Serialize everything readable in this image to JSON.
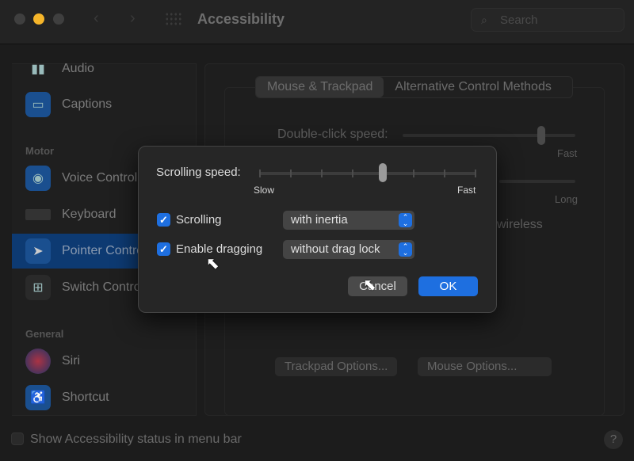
{
  "window": {
    "title": "Accessibility",
    "search_placeholder": "Search"
  },
  "sidebar": {
    "items": [
      {
        "label": "Audio",
        "icon": "audio-icon"
      },
      {
        "label": "Captions",
        "icon": "captions-icon"
      },
      {
        "section": "Motor"
      },
      {
        "label": "Voice Control",
        "icon": "voice-control-icon"
      },
      {
        "label": "Keyboard",
        "icon": "keyboard-icon"
      },
      {
        "label": "Pointer Control",
        "icon": "pointer-icon",
        "selected": true
      },
      {
        "label": "Switch Control",
        "icon": "switch-control-icon"
      },
      {
        "section": "General"
      },
      {
        "label": "Siri",
        "icon": "siri-icon"
      },
      {
        "label": "Shortcut",
        "icon": "shortcut-icon"
      }
    ]
  },
  "tabs": [
    "Mouse & Trackpad",
    "Alternative Control Methods"
  ],
  "background": {
    "double_click_label": "Double-click speed:",
    "double_click_value": 0.8,
    "fast": "Fast",
    "long": "Long",
    "wireless": "wireless",
    "trackpad_options": "Trackpad Options...",
    "mouse_options": "Mouse Options..."
  },
  "dialog": {
    "scrolling_speed_label": "Scrolling speed:",
    "scrolling_speed_value": 0.57,
    "slow": "Slow",
    "fast": "Fast",
    "scrolling": {
      "label": "Scrolling",
      "checked": true,
      "option": "with inertia"
    },
    "dragging": {
      "label": "Enable dragging",
      "checked": true,
      "option": "without drag lock"
    },
    "cancel": "Cancel",
    "ok": "OK"
  },
  "footer": {
    "status_label": "Show Accessibility status in menu bar",
    "checked": false,
    "help": "?"
  },
  "colors": {
    "accent": "#1e6fe0",
    "close": "#3f3f3f",
    "minimize": "#f5b52a"
  }
}
